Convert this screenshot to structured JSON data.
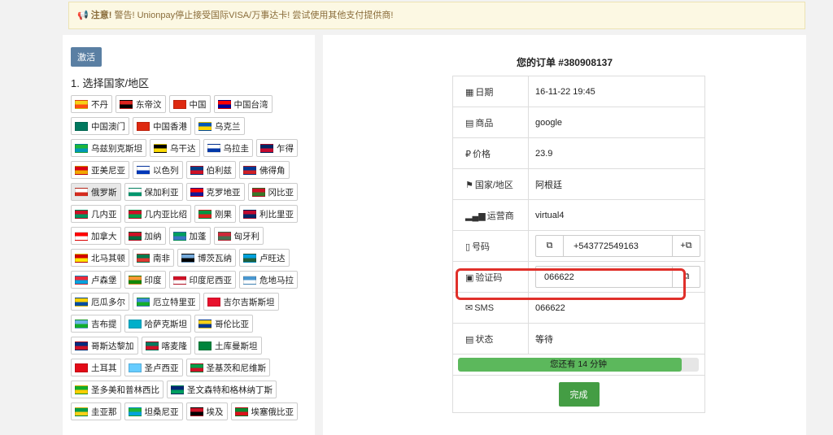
{
  "alert": {
    "strong": "注意!",
    "text": " 警告! Unionpay停止接受国际VISA/万事达卡! 尝试使用其他支付提供商!"
  },
  "left": {
    "activate_label": "激活",
    "section_title": "1. 选择国家/地区",
    "countries": [
      {
        "name": "不丹",
        "colors": [
          "#f7d116",
          "#ff4e12"
        ]
      },
      {
        "name": "东帝汶",
        "colors": [
          "#dc241f",
          "#000000"
        ]
      },
      {
        "name": "中国",
        "colors": [
          "#de2910",
          "#de2910"
        ]
      },
      {
        "name": "中国台湾",
        "colors": [
          "#fe0000",
          "#000095"
        ]
      },
      {
        "name": "中国澳门",
        "colors": [
          "#00785e",
          "#00785e"
        ]
      },
      {
        "name": "中国香港",
        "colors": [
          "#de2910",
          "#de2910"
        ]
      },
      {
        "name": "乌克兰",
        "colors": [
          "#0057b7",
          "#ffd700"
        ]
      },
      {
        "name": "乌兹别克斯坦",
        "colors": [
          "#1eb53a",
          "#0099b5"
        ]
      },
      {
        "name": "乌干达",
        "colors": [
          "#000000",
          "#fcdc04"
        ]
      },
      {
        "name": "乌拉圭",
        "colors": [
          "#ffffff",
          "#0038a8"
        ]
      },
      {
        "name": "乍得",
        "colors": [
          "#002664",
          "#c60c30"
        ]
      },
      {
        "name": "亚美尼亚",
        "colors": [
          "#d90012",
          "#f2a800"
        ]
      },
      {
        "name": "以色列",
        "colors": [
          "#ffffff",
          "#0038b8"
        ]
      },
      {
        "name": "伯利兹",
        "colors": [
          "#003f87",
          "#ce1126"
        ]
      },
      {
        "name": "佛得角",
        "colors": [
          "#003893",
          "#cf2027"
        ]
      },
      {
        "name": "俄罗斯",
        "colors": [
          "#ffffff",
          "#d52b1e"
        ]
      },
      {
        "name": "保加利亚",
        "colors": [
          "#ffffff",
          "#00966e"
        ]
      },
      {
        "name": "克罗地亚",
        "colors": [
          "#ff0000",
          "#171796"
        ]
      },
      {
        "name": "冈比亚",
        "colors": [
          "#ce1126",
          "#3a7728"
        ]
      },
      {
        "name": "几内亚",
        "colors": [
          "#ce1126",
          "#009460"
        ]
      },
      {
        "name": "几内亚比绍",
        "colors": [
          "#ce1126",
          "#009e49"
        ]
      },
      {
        "name": "刚果",
        "colors": [
          "#009543",
          "#dc241f"
        ]
      },
      {
        "name": "利比里亚",
        "colors": [
          "#bf0a30",
          "#002868"
        ]
      },
      {
        "name": "加拿大",
        "colors": [
          "#ff0000",
          "#ffffff"
        ]
      },
      {
        "name": "加纳",
        "colors": [
          "#ce1126",
          "#006b3f"
        ]
      },
      {
        "name": "加蓬",
        "colors": [
          "#009e60",
          "#3a75c4"
        ]
      },
      {
        "name": "匈牙利",
        "colors": [
          "#ce2939",
          "#477050"
        ]
      },
      {
        "name": "北马其顿",
        "colors": [
          "#d20000",
          "#ffe600"
        ]
      },
      {
        "name": "南非",
        "colors": [
          "#007a4d",
          "#de3831"
        ]
      },
      {
        "name": "博茨瓦纳",
        "colors": [
          "#75aadb",
          "#000000"
        ]
      },
      {
        "name": "卢旺达",
        "colors": [
          "#00a1de",
          "#20603d"
        ]
      },
      {
        "name": "卢森堡",
        "colors": [
          "#ed2939",
          "#00a1de"
        ]
      },
      {
        "name": "印度",
        "colors": [
          "#ff9933",
          "#138808"
        ]
      },
      {
        "name": "印度尼西亚",
        "colors": [
          "#ce1126",
          "#ffffff"
        ]
      },
      {
        "name": "危地马拉",
        "colors": [
          "#4997d0",
          "#ffffff"
        ]
      },
      {
        "name": "厄瓜多尔",
        "colors": [
          "#ffd100",
          "#034ea2"
        ]
      },
      {
        "name": "厄立特里亚",
        "colors": [
          "#4189dd",
          "#12ad2b"
        ]
      },
      {
        "name": "吉尔吉斯斯坦",
        "colors": [
          "#e8112d",
          "#e8112d"
        ]
      },
      {
        "name": "吉布提",
        "colors": [
          "#6ab2e7",
          "#12ad2b"
        ]
      },
      {
        "name": "哈萨克斯坦",
        "colors": [
          "#00afca",
          "#00afca"
        ]
      },
      {
        "name": "哥伦比亚",
        "colors": [
          "#fcd116",
          "#003893"
        ]
      },
      {
        "name": "哥斯达黎加",
        "colors": [
          "#002b7f",
          "#ce1126"
        ]
      },
      {
        "name": "喀麦隆",
        "colors": [
          "#007a5e",
          "#ce1126"
        ]
      },
      {
        "name": "土库曼斯坦",
        "colors": [
          "#00843d",
          "#00843d"
        ]
      },
      {
        "name": "土耳其",
        "colors": [
          "#e30a17",
          "#e30a17"
        ]
      },
      {
        "name": "圣卢西亚",
        "colors": [
          "#66ccff",
          "#66ccff"
        ]
      },
      {
        "name": "圣基茨和尼维斯",
        "colors": [
          "#009e49",
          "#ce1126"
        ]
      },
      {
        "name": "圣多美和普林西比",
        "colors": [
          "#12ad2b",
          "#ffce00"
        ]
      },
      {
        "name": "圣文森特和格林纳丁斯",
        "colors": [
          "#002674",
          "#009e60"
        ]
      },
      {
        "name": "圭亚那",
        "colors": [
          "#009e49",
          "#fcd116"
        ]
      },
      {
        "name": "坦桑尼亚",
        "colors": [
          "#1eb53a",
          "#00a3dd"
        ]
      },
      {
        "name": "埃及",
        "colors": [
          "#ce1126",
          "#000000"
        ]
      },
      {
        "name": "埃塞俄比亚",
        "colors": [
          "#078930",
          "#da121a"
        ]
      }
    ]
  },
  "order": {
    "title": "您的订单 #380908137",
    "rows": [
      {
        "icon": "▦",
        "label": "日期",
        "value": "16-11-22 19:45"
      },
      {
        "icon": "▤",
        "label": "商品",
        "value": "google"
      },
      {
        "icon": "₽",
        "label": "价格",
        "value": "23.9"
      },
      {
        "icon": "⚑",
        "label": "国家/地区",
        "value": "阿根廷"
      },
      {
        "icon": "▂▄▆",
        "label": "运营商",
        "value": "virtual4"
      }
    ],
    "phone": {
      "icon": "▯",
      "label": "号码",
      "value": "+543772549163"
    },
    "code": {
      "icon": "▣",
      "label": "验证码",
      "value": "066622"
    },
    "sms": {
      "icon": "✉",
      "label": "SMS",
      "value": "066622"
    },
    "status": {
      "icon": "▤",
      "label": "状态",
      "value": "等待"
    },
    "progress": {
      "text": "您还有 14 分钟",
      "fraction": 0.93
    },
    "done_label": "完成"
  }
}
